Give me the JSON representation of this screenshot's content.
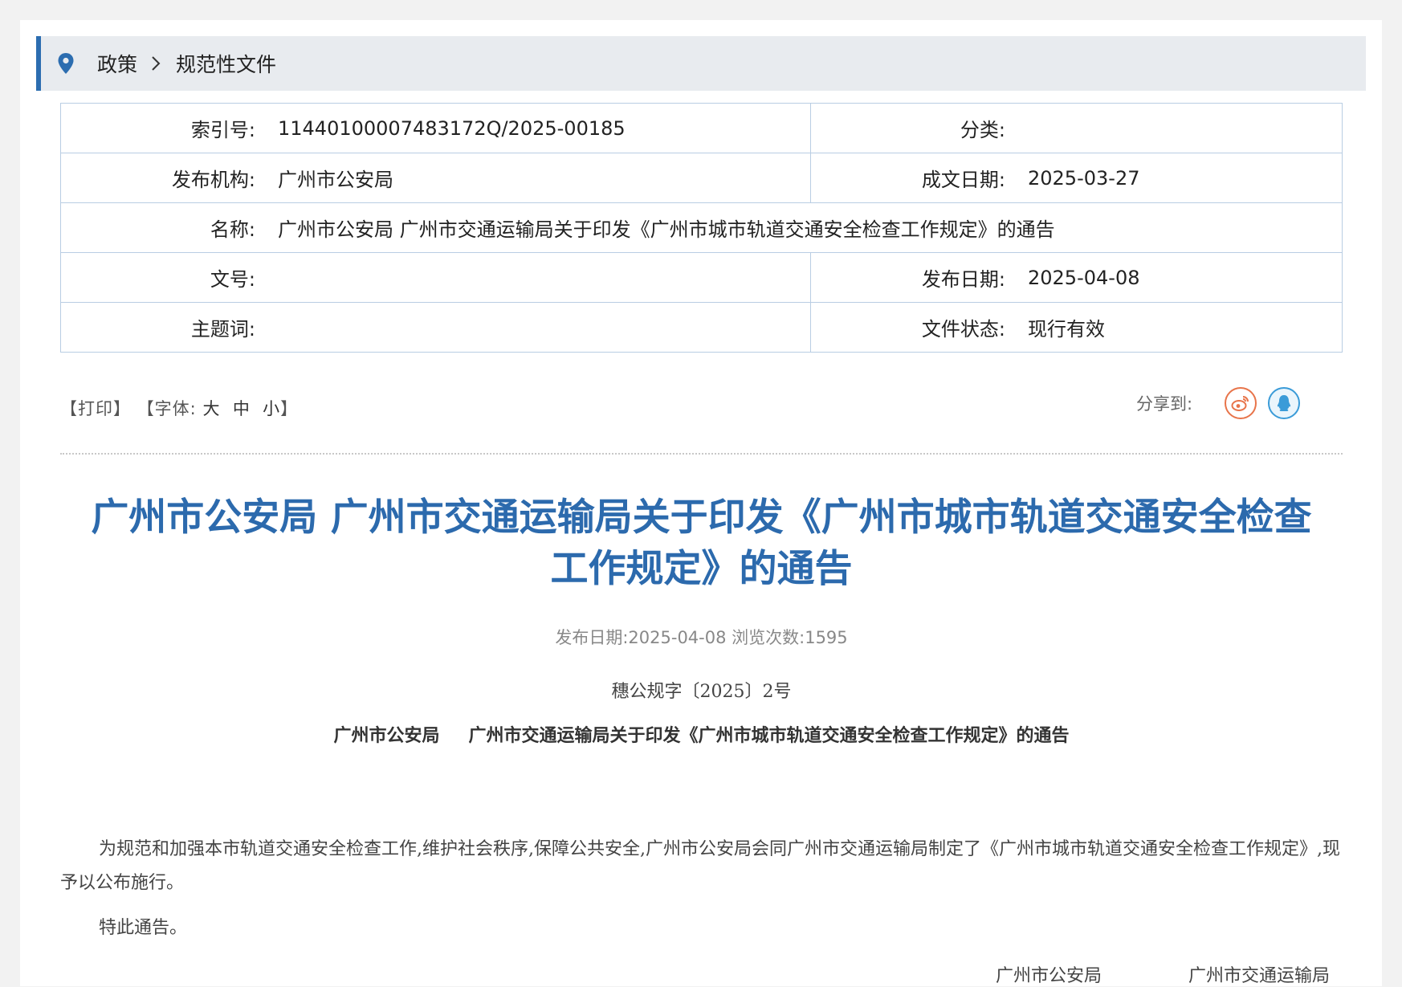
{
  "breadcrumb": {
    "items": [
      "政策",
      "规范性文件"
    ]
  },
  "info": {
    "index_label": "索引号:",
    "index_value": "11440100007483172Q/2025-00185",
    "category_label": "分类:",
    "category_value": "",
    "issuer_label": "发布机构:",
    "issuer_value": "广州市公安局",
    "written_date_label": "成文日期:",
    "written_date_value": "2025-03-27",
    "name_label": "名称:",
    "name_value": "广州市公安局 广州市交通运输局关于印发《广州市城市轨道交通安全检查工作规定》的通告",
    "docno_label": "文号:",
    "docno_value": "",
    "publish_date_label": "发布日期:",
    "publish_date_value": "2025-04-08",
    "subject_label": "主题词:",
    "subject_value": "",
    "status_label": "文件状态:",
    "status_value": "现行有效"
  },
  "tools": {
    "print": "【打印】",
    "font_prefix": "【字体:",
    "font_large": "大",
    "font_medium": "中",
    "font_small": "小",
    "font_suffix": "】"
  },
  "share": {
    "label": "分享到:",
    "icons": [
      "weibo-icon",
      "qq-icon"
    ]
  },
  "article": {
    "title_line1": "广州市公安局 广州市交通运输局关于印发《广州市城市轨道交通安全检查",
    "title_line2": "工作规定》的通告",
    "meta": "发布日期:2025-04-08  浏览次数:1595",
    "docno": "穗公规字〔2025〕2号",
    "subtitle_left": "广州市公安局",
    "subtitle_right": "广州市交通运输局关于印发《广州市城市轨道交通安全检查工作规定》的通告",
    "paragraph1": "为规范和加强本市轨道交通安全检查工作,维护社会秩序,保障公共安全,广州市公安局会同广州市交通运输局制定了《广州市城市轨道交通安全检查工作规定》,现予以公布施行。",
    "paragraph2": "特此通告。",
    "sign_left": "广州市公安局",
    "sign_right": "广州市交通运输局"
  },
  "colors": {
    "accent": "#2c6db0",
    "title": "#2c6aad",
    "table_border": "#b9cde3",
    "weibo": "#e8744a",
    "qq": "#3a9bd8"
  }
}
